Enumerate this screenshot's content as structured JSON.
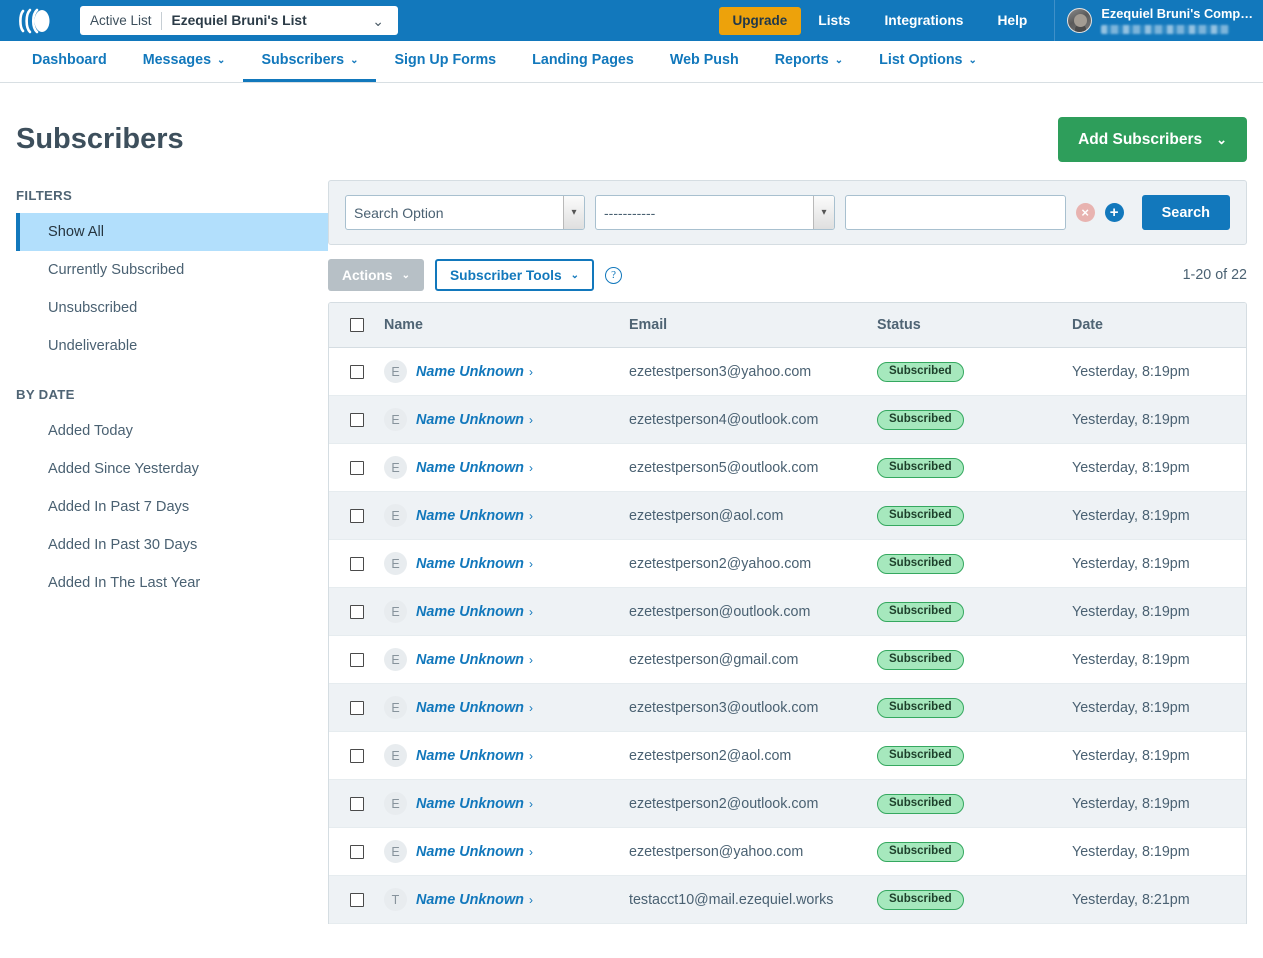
{
  "topbar": {
    "logo_name": "aweber-logo",
    "active_list_label": "Active List",
    "active_list_value": "Ezequiel Bruni's List",
    "caret": "⌄",
    "upgrade_label": "Upgrade",
    "links": [
      {
        "label": "Lists"
      },
      {
        "label": "Integrations"
      },
      {
        "label": "Help"
      }
    ],
    "user_name": "Ezequiel Bruni's Comp…"
  },
  "nav": {
    "items": [
      {
        "label": "Dashboard",
        "caret": false,
        "active": false
      },
      {
        "label": "Messages",
        "caret": true,
        "active": false
      },
      {
        "label": "Subscribers",
        "caret": true,
        "active": true
      },
      {
        "label": "Sign Up Forms",
        "caret": false,
        "active": false
      },
      {
        "label": "Landing Pages",
        "caret": false,
        "active": false
      },
      {
        "label": "Web Push",
        "caret": false,
        "active": false
      },
      {
        "label": "Reports",
        "caret": true,
        "active": false
      },
      {
        "label": "List Options",
        "caret": true,
        "active": false
      }
    ],
    "caret_glyph": "⌄"
  },
  "page": {
    "title": "Subscribers",
    "add_subscribers_label": "Add Subscribers",
    "add_subscribers_caret": "⌄"
  },
  "sidebar": {
    "filters_heading": "FILTERS",
    "filters": [
      {
        "label": "Show All",
        "selected": true
      },
      {
        "label": "Currently Subscribed",
        "selected": false
      },
      {
        "label": "Unsubscribed",
        "selected": false
      },
      {
        "label": "Undeliverable",
        "selected": false
      }
    ],
    "bydate_heading": "BY DATE",
    "bydate": [
      {
        "label": "Added Today"
      },
      {
        "label": "Added Since Yesterday"
      },
      {
        "label": "Added In Past 7 Days"
      },
      {
        "label": "Added In Past 30 Days"
      },
      {
        "label": "Added In The Last Year"
      }
    ]
  },
  "search": {
    "option_value": "Search Option",
    "field_value": "-----------",
    "query_value": "",
    "query_placeholder": "",
    "remove_icon": "×",
    "add_icon": "+",
    "search_label": "Search"
  },
  "toolbar": {
    "actions_label": "Actions",
    "tools_label": "Subscriber Tools",
    "caret": "⌄",
    "help_glyph": "?",
    "count_text": "1-20 of 22"
  },
  "table": {
    "columns": [
      "Name",
      "Email",
      "Status",
      "Date"
    ],
    "rows": [
      {
        "initial": "E",
        "name": "Name Unknown",
        "email": "ezetestperson3@yahoo.com",
        "status": "Subscribed",
        "date": "Yesterday, 8:19pm"
      },
      {
        "initial": "E",
        "name": "Name Unknown",
        "email": "ezetestperson4@outlook.com",
        "status": "Subscribed",
        "date": "Yesterday, 8:19pm"
      },
      {
        "initial": "E",
        "name": "Name Unknown",
        "email": "ezetestperson5@outlook.com",
        "status": "Subscribed",
        "date": "Yesterday, 8:19pm"
      },
      {
        "initial": "E",
        "name": "Name Unknown",
        "email": "ezetestperson@aol.com",
        "status": "Subscribed",
        "date": "Yesterday, 8:19pm"
      },
      {
        "initial": "E",
        "name": "Name Unknown",
        "email": "ezetestperson2@yahoo.com",
        "status": "Subscribed",
        "date": "Yesterday, 8:19pm"
      },
      {
        "initial": "E",
        "name": "Name Unknown",
        "email": "ezetestperson@outlook.com",
        "status": "Subscribed",
        "date": "Yesterday, 8:19pm"
      },
      {
        "initial": "E",
        "name": "Name Unknown",
        "email": "ezetestperson@gmail.com",
        "status": "Subscribed",
        "date": "Yesterday, 8:19pm"
      },
      {
        "initial": "E",
        "name": "Name Unknown",
        "email": "ezetestperson3@outlook.com",
        "status": "Subscribed",
        "date": "Yesterday, 8:19pm"
      },
      {
        "initial": "E",
        "name": "Name Unknown",
        "email": "ezetestperson2@aol.com",
        "status": "Subscribed",
        "date": "Yesterday, 8:19pm"
      },
      {
        "initial": "E",
        "name": "Name Unknown",
        "email": "ezetestperson2@outlook.com",
        "status": "Subscribed",
        "date": "Yesterday, 8:19pm"
      },
      {
        "initial": "E",
        "name": "Name Unknown",
        "email": "ezetestperson@yahoo.com",
        "status": "Subscribed",
        "date": "Yesterday, 8:19pm"
      },
      {
        "initial": "T",
        "name": "Name Unknown",
        "email": "testacct10@mail.ezequiel.works",
        "status": "Subscribed",
        "date": "Yesterday, 8:21pm"
      }
    ],
    "name_chevron": "›"
  },
  "colors": {
    "brand_blue": "#1278bc",
    "upgrade_orange": "#eda20b",
    "add_green": "#2e9e5b",
    "badge_green_bg": "#a6e8bd",
    "badge_green_border": "#35a85f",
    "selected_filter_bg": "#b2dffc",
    "panel_gray": "#eef2f5"
  }
}
